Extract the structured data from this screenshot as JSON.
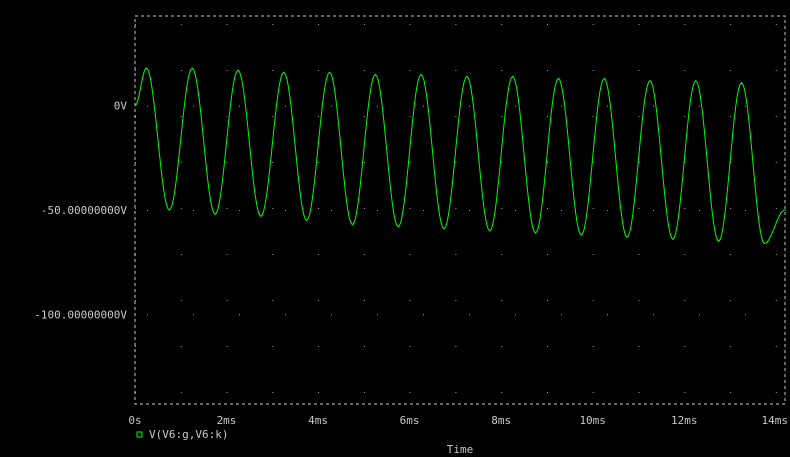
{
  "chart_data": {
    "type": "line",
    "title": "",
    "xlabel": "Time",
    "ylabel": "",
    "xlim": [
      0,
      14.2
    ],
    "ylim": [
      -143,
      43
    ],
    "x_unit": "ms",
    "y_unit": "V",
    "grid": "dotted",
    "x_ticks": [
      {
        "value": 0,
        "label": "0s"
      },
      {
        "value": 2,
        "label": "2ms"
      },
      {
        "value": 4,
        "label": "4ms"
      },
      {
        "value": 6,
        "label": "6ms"
      },
      {
        "value": 8,
        "label": "8ms"
      },
      {
        "value": 10,
        "label": "10ms"
      },
      {
        "value": 12,
        "label": "12ms"
      },
      {
        "value": 14,
        "label": "14ms"
      }
    ],
    "y_ticks": [
      {
        "value": 0,
        "label": "0V"
      },
      {
        "value": -50,
        "label": "-50.00000000V"
      },
      {
        "value": -100,
        "label": "-100.00000000V"
      }
    ],
    "legend": {
      "placement": "bottom-left",
      "entries": [
        {
          "name": "V(V6:g,V6:k)",
          "color": "#00ff00",
          "marker": "square"
        }
      ]
    },
    "series": [
      {
        "name": "V(V6:g,V6:k)",
        "color": "#00ff00",
        "x": [
          0,
          0.25,
          0.75,
          1.25,
          1.75,
          2.25,
          2.75,
          3.25,
          3.75,
          4.25,
          4.75,
          5.25,
          5.75,
          6.25,
          6.75,
          7.25,
          7.75,
          8.25,
          8.75,
          9.25,
          9.75,
          10.25,
          10.75,
          11.25,
          11.75,
          12.25,
          12.75,
          13.25,
          13.75,
          14.2
        ],
        "y": [
          0,
          18,
          -50,
          18,
          -52,
          17,
          -53,
          16,
          -55,
          16,
          -57,
          15,
          -58,
          15,
          -59,
          14,
          -60,
          14,
          -61,
          13,
          -62,
          13,
          -63,
          12,
          -64,
          12,
          -65,
          11,
          -66,
          -50
        ]
      }
    ]
  },
  "colors": {
    "background": "#000000",
    "frame": "#c8c8c8",
    "grid": "#a0a0a0",
    "trace": "#00ff00",
    "text": "#c8c8c8"
  }
}
